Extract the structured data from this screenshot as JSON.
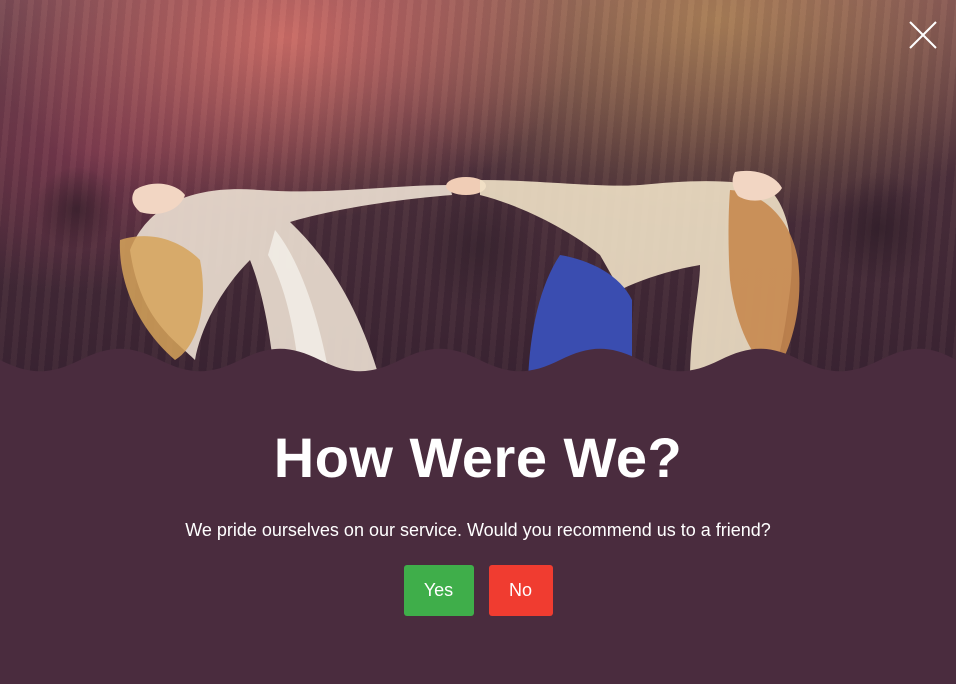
{
  "modal": {
    "title": "How Were We?",
    "subtitle": "We pride ourselves on our service. Would you recommend us to a friend?",
    "buttons": {
      "yes_label": "Yes",
      "no_label": "No"
    },
    "close_icon": "close-icon",
    "colors": {
      "background": "#4a2c3e",
      "yes": "#3fae4a",
      "no": "#f03c30",
      "text": "#ffffff"
    }
  }
}
